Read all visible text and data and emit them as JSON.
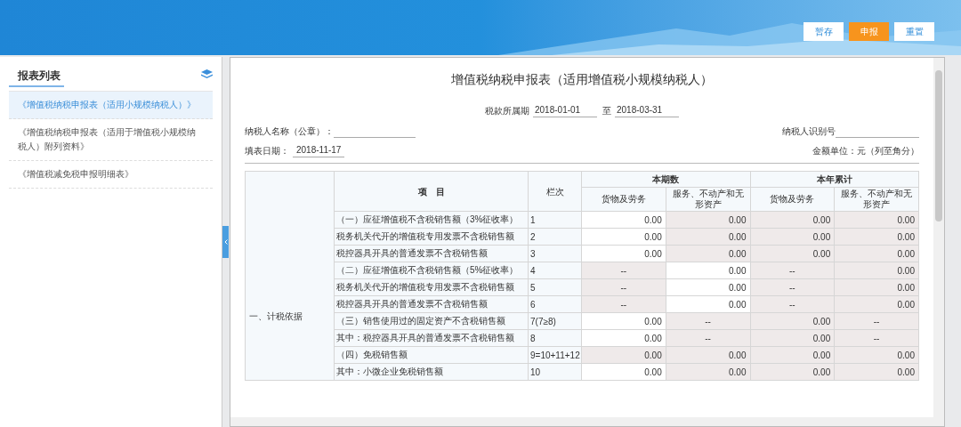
{
  "toolbar": {
    "buttons": [
      {
        "label": "暂存",
        "kind": "plain"
      },
      {
        "label": "申报",
        "kind": "primary"
      },
      {
        "label": "重置",
        "kind": "plain"
      }
    ]
  },
  "sidebar": {
    "title": "报表列表",
    "items": [
      {
        "label": "《增值税纳税申报表（适用小规模纳税人）》",
        "selected": true
      },
      {
        "label": "《增值税纳税申报表（适用于增值税小规模纳税人）附列资料》",
        "selected": false
      },
      {
        "label": "《增值税减免税申报明细表》",
        "selected": false
      }
    ]
  },
  "form": {
    "title": "增值税纳税申报表（适用增值税小规模纳税人）",
    "period_label": "税款所属期",
    "period_start": "2018-01-01",
    "period_to": "至",
    "period_end": "2018-03-31",
    "taxpayer_name_label": "纳税人名称（公章）：",
    "taxpayer_id_label": "纳税人识别号",
    "fill_date_label": "填表日期：",
    "fill_date": "2018-11-17",
    "unit": "金额单位：元（列至角分）",
    "table": {
      "section": "一、计税依据",
      "item_header": "项　目",
      "line_header": "栏次",
      "group_headers": [
        "本期数",
        "本年累计"
      ],
      "sub_headers": [
        "货物及劳务",
        "服务、不动产和无形资产",
        "货物及劳务",
        "服务、不动产和无形资产"
      ],
      "rows": [
        {
          "item": "（一）应征增值税不含税销售额（3%征收率）",
          "line": "1",
          "cells": [
            {
              "text": "0.00",
              "editable": true
            },
            {
              "text": "0.00",
              "editable": false
            },
            {
              "text": "0.00",
              "editable": false
            },
            {
              "text": "0.00",
              "editable": false
            }
          ]
        },
        {
          "item": "税务机关代开的增值税专用发票不含税销售额",
          "line": "2",
          "cells": [
            {
              "text": "0.00",
              "editable": true
            },
            {
              "text": "0.00",
              "editable": false
            },
            {
              "text": "0.00",
              "editable": false
            },
            {
              "text": "0.00",
              "editable": false
            }
          ]
        },
        {
          "item": "税控器具开具的普通发票不含税销售额",
          "line": "3",
          "cells": [
            {
              "text": "0.00",
              "editable": true
            },
            {
              "text": "0.00",
              "editable": false
            },
            {
              "text": "0.00",
              "editable": false
            },
            {
              "text": "0.00",
              "editable": false
            }
          ]
        },
        {
          "item": "（二）应征增值税不含税销售额（5%征收率）",
          "line": "4",
          "cells": [
            {
              "text": "--",
              "editable": false
            },
            {
              "text": "0.00",
              "editable": true
            },
            {
              "text": "--",
              "editable": false
            },
            {
              "text": "0.00",
              "editable": false
            }
          ]
        },
        {
          "item": "税务机关代开的增值税专用发票不含税销售额",
          "line": "5",
          "cells": [
            {
              "text": "--",
              "editable": false
            },
            {
              "text": "0.00",
              "editable": true
            },
            {
              "text": "--",
              "editable": false
            },
            {
              "text": "0.00",
              "editable": false
            }
          ]
        },
        {
          "item": "税控器具开具的普通发票不含税销售额",
          "line": "6",
          "cells": [
            {
              "text": "--",
              "editable": false
            },
            {
              "text": "0.00",
              "editable": true
            },
            {
              "text": "--",
              "editable": false
            },
            {
              "text": "0.00",
              "editable": false
            }
          ]
        },
        {
          "item": "（三）销售使用过的固定资产不含税销售额",
          "line": "7(7≥8)",
          "cells": [
            {
              "text": "0.00",
              "editable": true
            },
            {
              "text": "--",
              "editable": false
            },
            {
              "text": "0.00",
              "editable": false
            },
            {
              "text": "--",
              "editable": false
            }
          ]
        },
        {
          "item": "其中：税控器具开具的普通发票不含税销售额",
          "line": "8",
          "cells": [
            {
              "text": "0.00",
              "editable": true
            },
            {
              "text": "--",
              "editable": false
            },
            {
              "text": "0.00",
              "editable": false
            },
            {
              "text": "--",
              "editable": false
            }
          ]
        },
        {
          "item": "（四）免税销售额",
          "line": "9=10+11+12",
          "cells": [
            {
              "text": "0.00",
              "editable": false
            },
            {
              "text": "0.00",
              "editable": false
            },
            {
              "text": "0.00",
              "editable": false
            },
            {
              "text": "0.00",
              "editable": false
            }
          ]
        },
        {
          "item": "其中：小微企业免税销售额",
          "line": "10",
          "cells": [
            {
              "text": "0.00",
              "editable": true
            },
            {
              "text": "0.00",
              "editable": false
            },
            {
              "text": "0.00",
              "editable": false
            },
            {
              "text": "0.00",
              "editable": false
            }
          ]
        }
      ]
    }
  }
}
